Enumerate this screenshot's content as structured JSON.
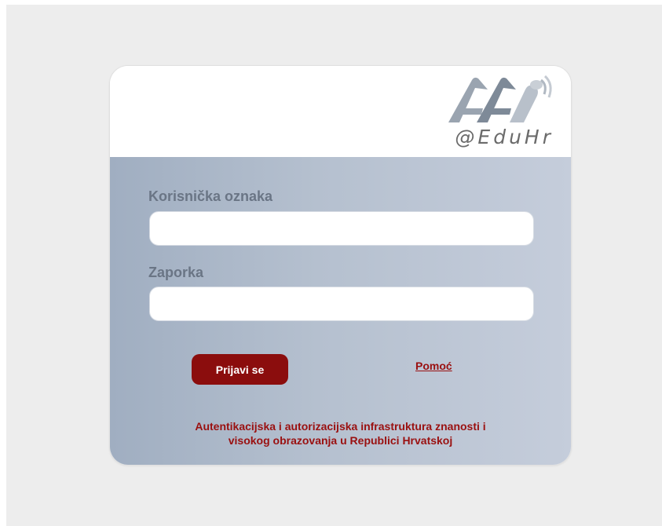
{
  "logo": {
    "text": "@EduHr",
    "icon": "aai-logo-icon"
  },
  "form": {
    "username_label": "Korisnička oznaka",
    "username_value": "",
    "password_label": "Zaporka",
    "password_value": "",
    "login_button_label": "Prijavi se",
    "help_link_label": "Pomoć"
  },
  "footer": {
    "line1": "Autentikacijska i autorizacijska infrastruktura znanosti i",
    "line2": "visokog obrazovanja u Republici Hrvatskoj"
  },
  "colors": {
    "accent": "#8b0d0d",
    "link": "#9a1010",
    "panel_start": "#a0aec1",
    "panel_end": "#c5cddb",
    "label": "#6a7585",
    "page_bg": "#ededed"
  }
}
